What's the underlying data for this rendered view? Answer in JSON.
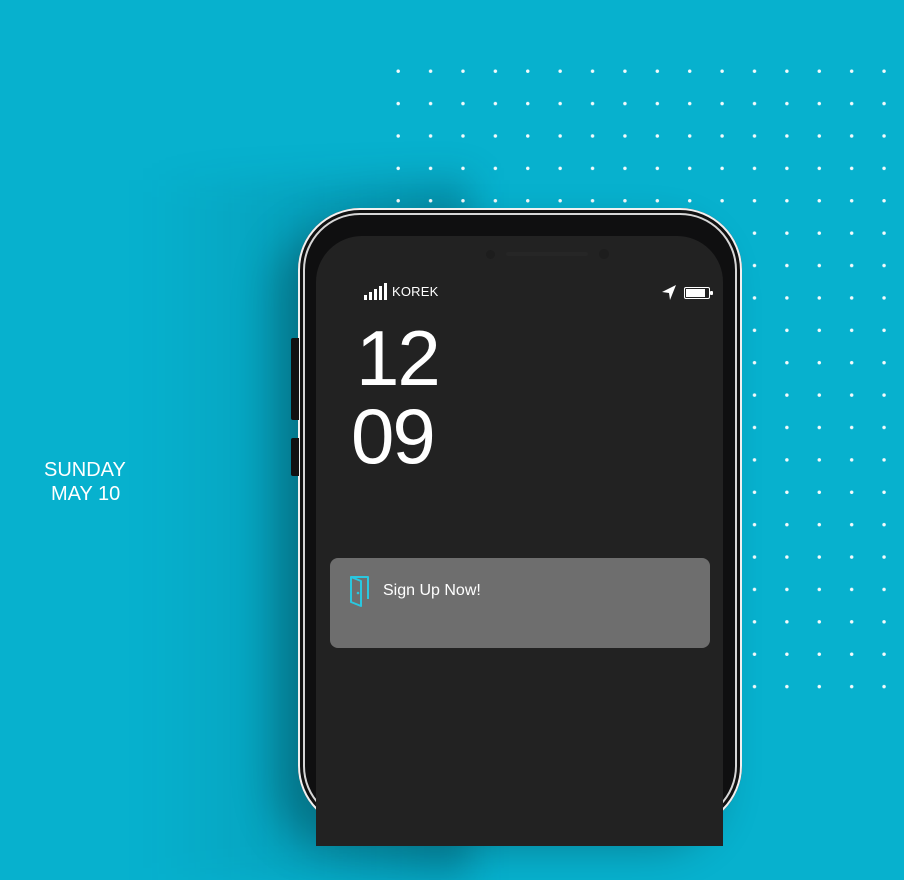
{
  "colors": {
    "background": "#07b1ce",
    "phone_frame": "#0f0f10",
    "screen": "#222222",
    "notification": "#6e6e6e",
    "accent": "#2ac7df"
  },
  "status_bar": {
    "carrier": "KOREK",
    "location_icon": "location-arrow-icon",
    "battery_icon": "battery-icon"
  },
  "lock_screen": {
    "hour": "12",
    "minute": "09",
    "day": "SUNDAY",
    "date": "MAY 10"
  },
  "notification": {
    "icon": "door-icon",
    "message": "Sign Up Now!"
  }
}
